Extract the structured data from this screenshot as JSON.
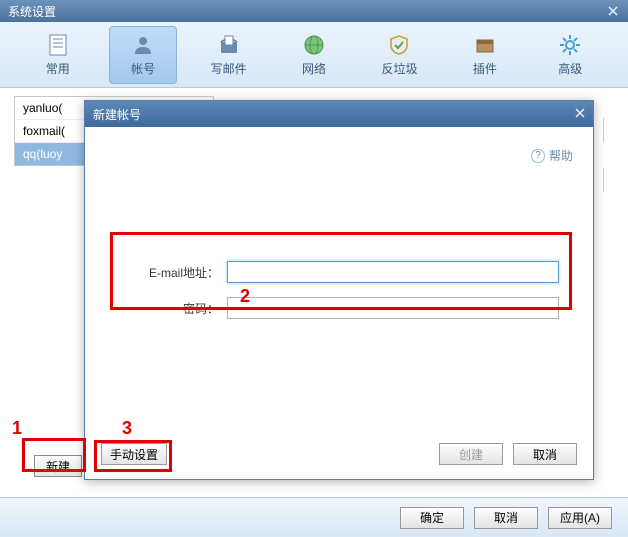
{
  "window": {
    "title": "系统设置",
    "close_icon": "close"
  },
  "toolbar": {
    "items": [
      {
        "label": "常用",
        "icon": "doc"
      },
      {
        "label": "帐号",
        "icon": "user",
        "active": true
      },
      {
        "label": "写邮件",
        "icon": "compose"
      },
      {
        "label": "网络",
        "icon": "globe"
      },
      {
        "label": "反垃圾",
        "icon": "shield"
      },
      {
        "label": "插件",
        "icon": "plugin"
      },
      {
        "label": "高级",
        "icon": "gear"
      }
    ]
  },
  "accounts": {
    "items": [
      {
        "label": "yanluo(",
        "selected": false
      },
      {
        "label": "foxmail(",
        "selected": false
      },
      {
        "label": "qq(luoy",
        "selected": true
      }
    ]
  },
  "new_button": "新建",
  "dialog": {
    "title": "新建帐号",
    "help_label": "帮助",
    "form": {
      "email_label": "E-mail地址：",
      "email_value": "",
      "password_label": "密码：",
      "password_value": ""
    },
    "buttons": {
      "manual": "手动设置",
      "create": "创建",
      "cancel": "取消"
    }
  },
  "footer": {
    "ok": "确定",
    "cancel": "取消",
    "apply": "应用(A)"
  },
  "annotations": {
    "one": "1",
    "two": "2",
    "three": "3"
  }
}
